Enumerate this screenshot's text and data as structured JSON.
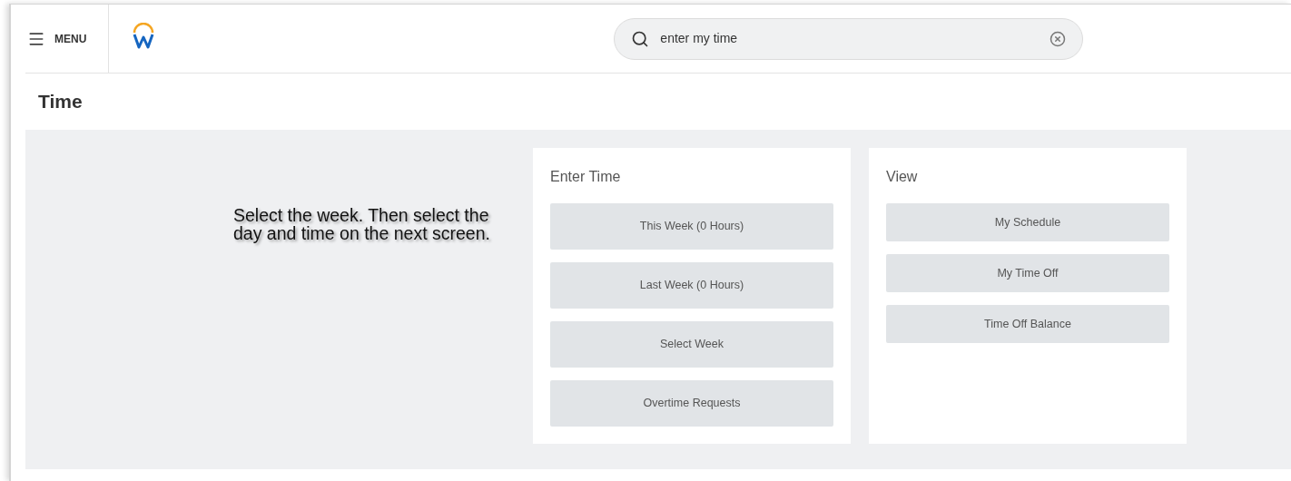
{
  "header": {
    "menu_label": "MENU",
    "search": {
      "value": "enter my time"
    }
  },
  "page_title": "Time",
  "instruction": "Select the week. Then select the day and time on the next screen.",
  "cards": [
    {
      "title": "Enter Time",
      "buttons": [
        "This Week (0 Hours)",
        "Last Week (0 Hours)",
        "Select Week",
        "Overtime Requests"
      ]
    },
    {
      "title": "View",
      "buttons": [
        "My Schedule",
        "My Time Off",
        "Time Off Balance"
      ]
    }
  ]
}
